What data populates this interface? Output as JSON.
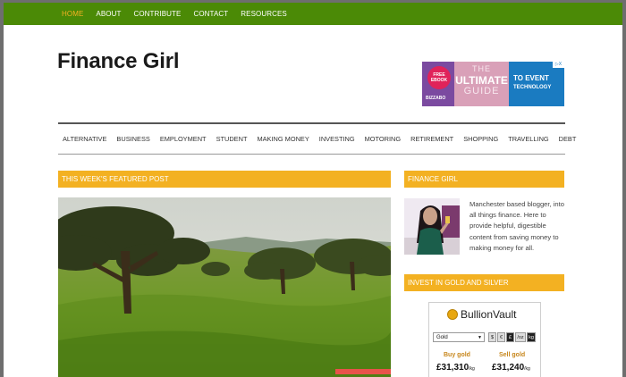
{
  "top_nav": {
    "items": [
      "HOME",
      "ABOUT",
      "CONTRIBUTE",
      "CONTACT",
      "RESOURCES"
    ],
    "active": "HOME",
    "active_color": "#f3b122",
    "bar_color": "#4b8a06"
  },
  "header": {
    "title": "Finance Girl",
    "ad": {
      "badge_line1": "FREE",
      "badge_line2": "EBOOK",
      "brand": "BIZZABO",
      "guide_line1": "THE",
      "guide_line2": "ULTIMATE",
      "guide_line3": "GUIDE",
      "text_line1": "TO EVENT",
      "text_line2": "TECHNOLOGY",
      "close_label": "▷X"
    }
  },
  "main_nav": {
    "items": [
      "ALTERNATIVE",
      "BUSINESS",
      "EMPLOYMENT",
      "STUDENT",
      "MAKING MONEY",
      "INVESTING",
      "MOTORING",
      "RETIREMENT",
      "SHOPPING",
      "TRAVELLING",
      "DEBT"
    ]
  },
  "featured": {
    "heading": "THIS WEEK'S FEATURED POST",
    "image": "landscape-photo"
  },
  "sidebar": {
    "profile_heading": "FINANCE GIRL",
    "bio": "Manchester based blogger, into all things finance. Here to provide helpful, digestible content from saving money to making money for all.",
    "gold_heading": "INVEST IN GOLD AND SILVER",
    "accent_color": "#f3b122"
  },
  "bullion": {
    "brand": "BullionVault",
    "metal": "Gold",
    "currencies": [
      "$",
      "€",
      "£"
    ],
    "active_currency": "£",
    "units": [
      "/oz",
      "kg"
    ],
    "active_unit": "kg",
    "buy_label": "Buy gold",
    "buy_price": "£31,310",
    "buy_unit": "/kg",
    "sell_label": "Sell gold",
    "sell_price": "£31,240",
    "sell_unit": "/kg"
  }
}
